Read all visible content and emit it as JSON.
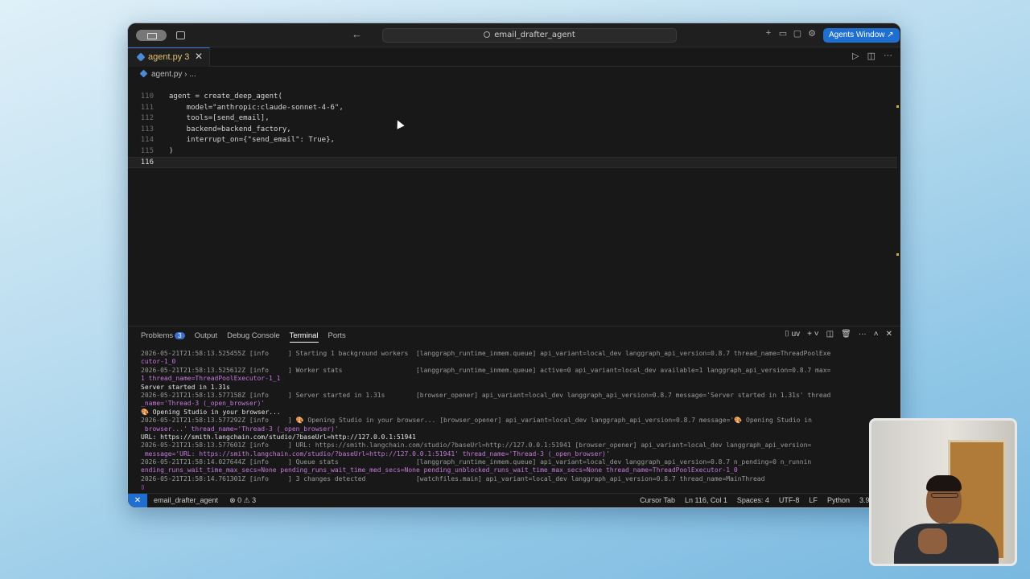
{
  "titlebar": {
    "search_text": "email_drafter_agent",
    "agents_button": "Agents Window ↗"
  },
  "tab": {
    "label": "agent.py 3",
    "close": "✕"
  },
  "breadcrumb": {
    "file": "agent.py",
    "sep": "›",
    "more": "..."
  },
  "code": {
    "top_fold": "109",
    "lines": [
      {
        "n": "110",
        "text": "agent = create_deep_agent("
      },
      {
        "n": "111",
        "text": "    model=\"anthropic:claude-sonnet-4-6\","
      },
      {
        "n": "112",
        "text": "    tools=[send_email],"
      },
      {
        "n": "113",
        "text": "    backend=backend_factory,"
      },
      {
        "n": "114",
        "text": "    interrupt_on={\"send_email\": True},"
      },
      {
        "n": "115",
        "text": ")"
      },
      {
        "n": "116",
        "text": ""
      }
    ]
  },
  "panel": {
    "tabs": [
      "Problems",
      "Output",
      "Debug Console",
      "Terminal",
      "Ports"
    ],
    "problems_count": "3",
    "active_tab": "Terminal",
    "shell_label": "uv"
  },
  "terminal": {
    "lines": [
      "2026-05-21T21:58:13.525455Z [info     ] Starting 1 background workers  [langgraph_runtime_inmem.queue] api_variant=local_dev langgraph_api_version=0.8.7 thread_name=ThreadPoolExe",
      "cutor-1_0",
      "2026-05-21T21:58:13.525612Z [info     ] Worker stats                   [langgraph_runtime_inmem.queue] active=0 api_variant=local_dev available=1 langgraph_api_version=0.8.7 max=",
      "1 thread_name=ThreadPoolExecutor-1_1",
      "Server started in 1.31s",
      "2026-05-21T21:58:13.577158Z [info     ] Server started in 1.31s        [browser_opener] api_variant=local_dev langgraph_api_version=0.8.7 message='Server started in 1.31s' thread",
      "_name='Thread-3 (_open_browser)'",
      "🎨 Opening Studio in your browser...",
      "2026-05-21T21:58:13.577292Z [info     ] 🎨 Opening Studio in your browser... [browser_opener] api_variant=local_dev langgraph_api_version=0.8.7 message='🎨 Opening Studio in",
      " browser...' thread_name='Thread-3 (_open_browser)'",
      "URL: https://smith.langchain.com/studio/?baseUrl=http://127.0.0.1:51941",
      "2026-05-21T21:58:13.577601Z [info     ] URL: https://smith.langchain.com/studio/?baseUrl=http://127.0.0.1:51941 [browser_opener] api_variant=local_dev langgraph_api_version=",
      " message='URL: https://smith.langchain.com/studio/?baseUrl=http://127.0.0.1:51941' thread_name='Thread-3 (_open_browser)'",
      "2026-05-21T21:58:14.027644Z [info     ] Queue stats                    [langgraph_runtime_inmem.queue] api_variant=local_dev langgraph_api_version=0.8.7 n_pending=0 n_runnin",
      "ending_runs_wait_time_max_secs=None pending_runs_wait_time_med_secs=None pending_unblocked_runs_wait_time_max_secs=None thread_name=ThreadPoolExecutor-1_0",
      "2026-05-21T21:58:14.761301Z [info     ] 3 changes detected             [watchfiles.main] api_variant=local_dev langgraph_api_version=0.8.7 thread_name=MainThread",
      "▯"
    ]
  },
  "statusbar": {
    "remote": "✕",
    "project": "email_drafter_agent",
    "problems": "⊗ 0 ⚠ 3",
    "cursor_tab": "Cursor Tab",
    "position": "Ln 116, Col 1",
    "spaces": "Spaces: 4",
    "encoding": "UTF-8",
    "eol": "LF",
    "language": "Python",
    "interpreter": "3.9.6 64-bit"
  }
}
